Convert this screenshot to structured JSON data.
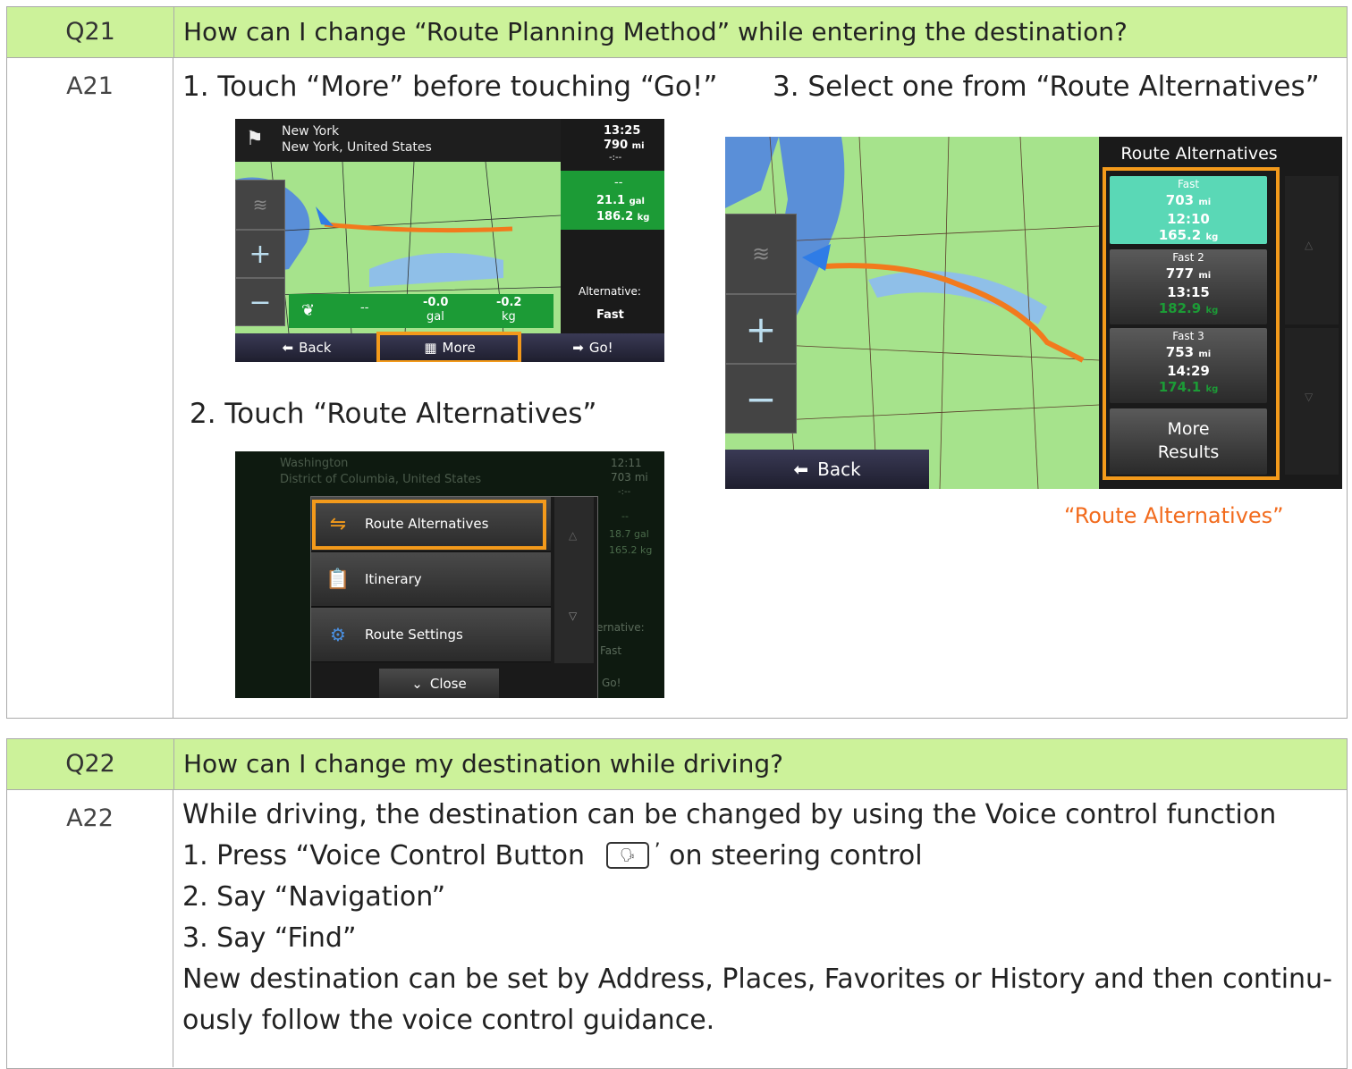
{
  "q21": {
    "number": "Q21",
    "question": "How can I change “Route Planning Method” while entering the destination?",
    "answer_number": "A21",
    "step1": "1.  Touch “More” before touching “Go!”",
    "step2": "2.  Touch “Route Alternatives”",
    "step3": "3.  Select one from “Route Alternatives”",
    "caption": "“Route Alternatives”",
    "screen1": {
      "dest_city": "New York",
      "dest_full": "New York, United States",
      "time": "13:25",
      "distance": "790",
      "distance_unit": "mi",
      "eta": "-:--",
      "dash": "--",
      "fuel": "21.1",
      "fuel_unit": "gal",
      "co2": "186.2",
      "co2_unit": "kg",
      "eco_dash": "--",
      "eco_fuel": "-0.0",
      "eco_fuel_unit": "gal",
      "eco_co2": "-0.2",
      "eco_co2_unit": "kg",
      "alternative_label": "Alternative:",
      "alternative_value": "Fast",
      "back": "Back",
      "more": "More",
      "go": "Go!"
    },
    "screen2": {
      "dest_city": "Washington",
      "dest_full": "District of Columbia, United States",
      "time": "12:11",
      "distance": "703 mi",
      "eta": "-:--",
      "dash": "--",
      "fuel": "18.7 gal",
      "co2": "165.2 kg",
      "alt_label": "ernative:",
      "alt_value": "Fast",
      "go": "Go!",
      "items": [
        "Route Alternatives",
        "Itinerary",
        "Route Settings"
      ],
      "close": "Close"
    },
    "screen3": {
      "title": "Route Alternatives",
      "routes": [
        {
          "name": "Fast",
          "distance": "703",
          "unit": "mi",
          "time": "12:10",
          "co2": "165.2",
          "co2_unit": "kg"
        },
        {
          "name": "Fast 2",
          "distance": "777",
          "unit": "mi",
          "time": "13:15",
          "co2": "182.9",
          "co2_unit": "kg"
        },
        {
          "name": "Fast 3",
          "distance": "753",
          "unit": "mi",
          "time": "14:29",
          "co2": "174.1",
          "co2_unit": "kg"
        }
      ],
      "more_results_1": "More",
      "more_results_2": "Results",
      "back": "Back"
    }
  },
  "q22": {
    "number": "Q22",
    "question": "How can I change my destination while driving?",
    "answer_number": "A22",
    "intro": "While driving, the destination can be changed by using the Voice control function",
    "step1_a": "1.  Press “Voice Control Button",
    "step1_b": "on steering control",
    "step2": "2.  Say “Navigation”",
    "step3": "3.  Say “Find”",
    "outro_1": "New destination can be set by Address, Places, Favorites or History  and then continu-",
    "outro_2": "ously follow the voice control guidance."
  },
  "colors": {
    "header_bg": "#ccf29a",
    "highlight": "#f39a1b",
    "caption": "#f26b1d"
  }
}
